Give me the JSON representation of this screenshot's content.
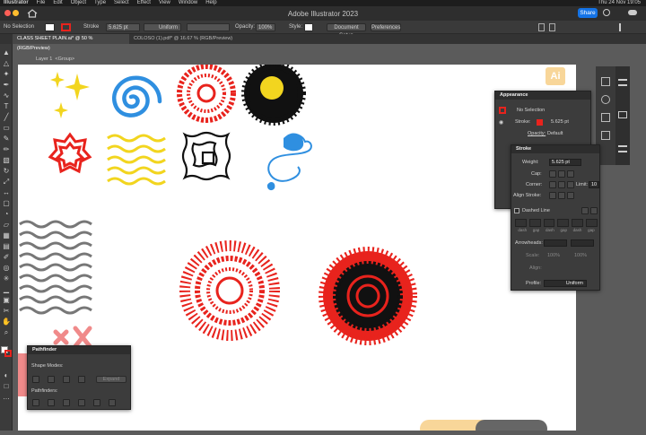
{
  "menubar": {
    "items": [
      "Illustrator",
      "File",
      "Edit",
      "Object",
      "Type",
      "Select",
      "Effect",
      "View",
      "Window",
      "Help"
    ],
    "clock": "Thu 24 Nov 19:05"
  },
  "window": {
    "title": "Adobe Illustrator 2023",
    "share": "Share"
  },
  "control": {
    "selection": "No Selection",
    "stroke_label": "Stroke",
    "stroke_weight": "5.625 pt",
    "profile": "Uniform",
    "opacity_label": "Opacity:",
    "opacity": "100%",
    "style_label": "Style:",
    "doc_setup": "Document Setup",
    "preferences": "Preferences"
  },
  "tabs": [
    {
      "label": "CLASS SHEET PLAIN.ai* @ 50 % (RGB/Preview)"
    },
    {
      "label": "COLOSO (1).pdf* @ 16.67 % (RGB/Preview)"
    }
  ],
  "layer": {
    "name": "Layer 1",
    "group": "<Group>"
  },
  "appearance": {
    "title": "Appearance",
    "no_selection": "No Selection",
    "stroke_label": "Stroke:",
    "stroke_value": "5.625 pt",
    "opacity_label": "Opacity:",
    "opacity_value": "Default"
  },
  "stroke": {
    "title": "Stroke",
    "weight_label": "Weight:",
    "weight": "5.625 pt",
    "cap_label": "Cap:",
    "corner_label": "Corner:",
    "limit_label": "Limit:",
    "limit": "10",
    "align_label": "Align Stroke:",
    "dashed_label": "Dashed Line",
    "dash_labels": [
      "dash",
      "gap",
      "dash",
      "gap",
      "dash",
      "gap"
    ],
    "arrowheads_label": "Arrowheads:",
    "scale_label": "Scale:",
    "scale_values": [
      "100%",
      "100%"
    ],
    "align_label2": "Align:",
    "profile_label": "Profile:",
    "profile": "Uniform"
  },
  "pathfinder": {
    "title": "Pathfinder",
    "shape_modes": "Shape Modes:",
    "expand": "Expand",
    "pathfinders": "Pathfinders:"
  },
  "badge": {
    "text": "Ai"
  },
  "colors": {
    "red": "#e8231d",
    "yellow": "#f2d51f",
    "blue": "#2f8fe0",
    "black": "#111111",
    "gray": "#777777",
    "accent": "#1473e6"
  }
}
